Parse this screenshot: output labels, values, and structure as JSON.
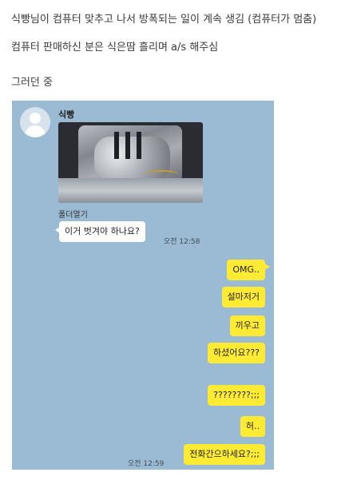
{
  "captions": [
    "식빵님이 컴퓨터 맞추고 나서 방폭되는 일이 계속 생김 (컴퓨터가 멈춤)",
    "컴퓨터 판매하신 분은 식은땀 흘리며 a/s 해주심",
    "그러던 중"
  ],
  "chat": {
    "background_color": "#9bbbd4",
    "sender_name": "식빵",
    "attachment_link": "폴더열기",
    "incoming": {
      "text": "이거 벗겨야 하나요?",
      "time": "오전 12:58"
    },
    "outgoing": [
      "OMG..",
      "설마저거",
      "끼우고",
      "하셨어요???",
      "????????;;;",
      "허..",
      "전화간으하세요?;;;"
    ],
    "outgoing_time": "오전 12:59",
    "bubble_colors": {
      "incoming": "#ffffff",
      "outgoing": "#ffeb33"
    }
  }
}
